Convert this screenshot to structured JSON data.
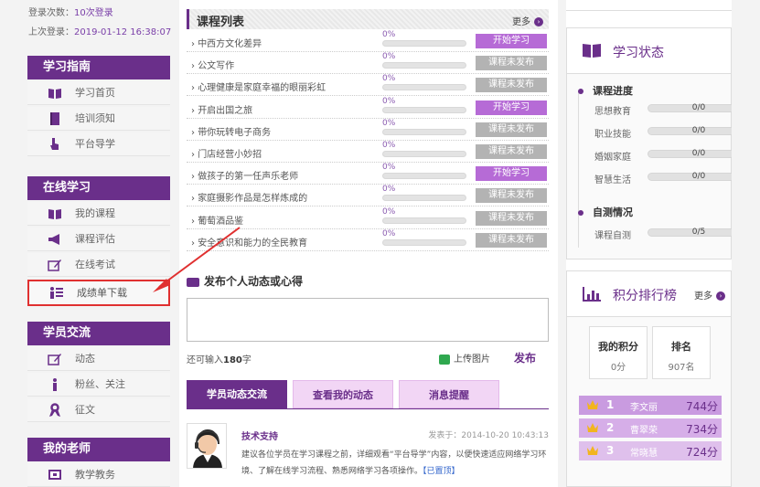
{
  "login": {
    "count_label": "登录次数：",
    "count_value": "10次登录",
    "last_label": "上次登录：",
    "last_value": "2019-01-12 16:38:07"
  },
  "sidebar": {
    "sections": [
      {
        "title": "学习指南",
        "items": [
          {
            "label": "学习首页",
            "icon": "book-icon"
          },
          {
            "label": "培训须知",
            "icon": "notebook-icon"
          },
          {
            "label": "平台导学",
            "icon": "pointer-icon"
          }
        ]
      },
      {
        "title": "在线学习",
        "items": [
          {
            "label": "我的课程",
            "icon": "book-icon"
          },
          {
            "label": "课程评估",
            "icon": "megaphone-icon"
          },
          {
            "label": "在线考试",
            "icon": "pencil-icon"
          },
          {
            "label": "成绩单下载",
            "icon": "list-icon"
          }
        ]
      },
      {
        "title": "学员交流",
        "items": [
          {
            "label": "动态",
            "icon": "pencil-icon"
          },
          {
            "label": "粉丝、关注",
            "icon": "person-icon"
          },
          {
            "label": "征文",
            "icon": "ribbon-icon"
          }
        ]
      },
      {
        "title": "我的老师",
        "items": [
          {
            "label": "教学教务",
            "icon": "board-icon"
          }
        ]
      }
    ]
  },
  "courses": {
    "title": "课程列表",
    "more": "更多",
    "start_label": "开始学习",
    "closed_label": "课程未发布",
    "items": [
      {
        "name": "中西方文化差异",
        "percent": "0%",
        "progress": 0,
        "status": "start"
      },
      {
        "name": "公文写作",
        "percent": "0%",
        "progress": 0,
        "status": "closed"
      },
      {
        "name": "心理健康是家庭幸福的眼丽彩虹",
        "percent": "0%",
        "progress": 0,
        "status": "closed"
      },
      {
        "name": "开启出国之旅",
        "percent": "0%",
        "progress": 0,
        "status": "start"
      },
      {
        "name": "带你玩转电子商务",
        "percent": "0%",
        "progress": 0,
        "status": "closed"
      },
      {
        "name": "门店经营小妙招",
        "percent": "0%",
        "progress": 0,
        "status": "closed"
      },
      {
        "name": "做孩子的第一任声乐老师",
        "percent": "0%",
        "progress": 0,
        "status": "start"
      },
      {
        "name": "家庭摄影作品是怎样炼成的",
        "percent": "0%",
        "progress": 0,
        "status": "closed"
      },
      {
        "name": "葡萄酒品鉴",
        "percent": "0%",
        "progress": 0,
        "status": "closed"
      },
      {
        "name": "安全意识和能力的全民教育",
        "percent": "0%",
        "progress": 0,
        "status": "closed"
      }
    ]
  },
  "post": {
    "title": "发布个人动态或心得",
    "remain_prefix": "还可输入",
    "remain_count": "180",
    "remain_suffix": "字",
    "upload_label": "上传图片",
    "publish_label": "发布"
  },
  "tabs": [
    {
      "label": "学员动态交流",
      "active": true
    },
    {
      "label": "查看我的动态",
      "active": false
    },
    {
      "label": "消息提醒",
      "active": false
    }
  ],
  "feed": {
    "author": "技术支持",
    "time": "发表于：2014-10-20 10:43:13",
    "content": "建议各位学员在学习课程之前，详细观看“平台导学”内容，以便快速适应网络学习环境、了解在线学习流程、熟悉网络学习各项操作。",
    "top_tag": "【已置顶】"
  },
  "study_status": {
    "title": "学习状态",
    "progress_title": "课程进度",
    "progress": [
      {
        "label": "思想教育",
        "value": "0/0"
      },
      {
        "label": "职业技能",
        "value": "0/0"
      },
      {
        "label": "婚姻家庭",
        "value": "0/0"
      },
      {
        "label": "智慧生活",
        "value": "0/0"
      }
    ],
    "selftest_title": "自测情况",
    "selftest": [
      {
        "label": "课程自测",
        "value": "0/5"
      }
    ]
  },
  "ranking": {
    "title": "积分排行榜",
    "more": "更多",
    "my_score_label": "我的积分",
    "my_score_value": "0分",
    "rank_label": "排名",
    "rank_value": "907名",
    "entries": [
      {
        "rank": "1",
        "name": "李文丽",
        "score": "744分"
      },
      {
        "rank": "2",
        "name": "曹翠荣",
        "score": "734分"
      },
      {
        "rank": "3",
        "name": "常晓慧",
        "score": "724分"
      }
    ]
  },
  "colors": {
    "brand_purple": "#6a2f8a",
    "start_button": "#b66bd6",
    "closed_button": "#b3b3b3",
    "highlight_red": "#e03030"
  }
}
